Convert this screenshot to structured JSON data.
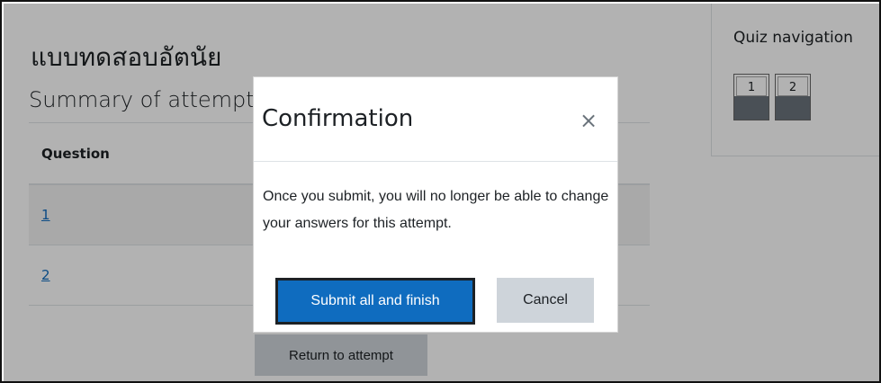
{
  "page": {
    "quiz_title": "แบบทดสอบอัตนัย",
    "summary_heading": "Summary of attempt",
    "table": {
      "header": "Question",
      "rows": [
        {
          "question": "1"
        },
        {
          "question": "2"
        }
      ]
    },
    "return_button": "Return to attempt"
  },
  "quiz_navigation": {
    "title": "Quiz navigation",
    "buttons": [
      "1",
      "2"
    ]
  },
  "modal": {
    "title": "Confirmation",
    "close_symbol": "×",
    "body": "Once you submit, you will no longer be able to change your answers for this attempt.",
    "submit_label": "Submit all and finish",
    "cancel_label": "Cancel"
  },
  "colors": {
    "primary": "#0f6cbf",
    "secondary": "#ced4da",
    "text": "#1d2125",
    "question_state_fill": "#6a737b"
  }
}
